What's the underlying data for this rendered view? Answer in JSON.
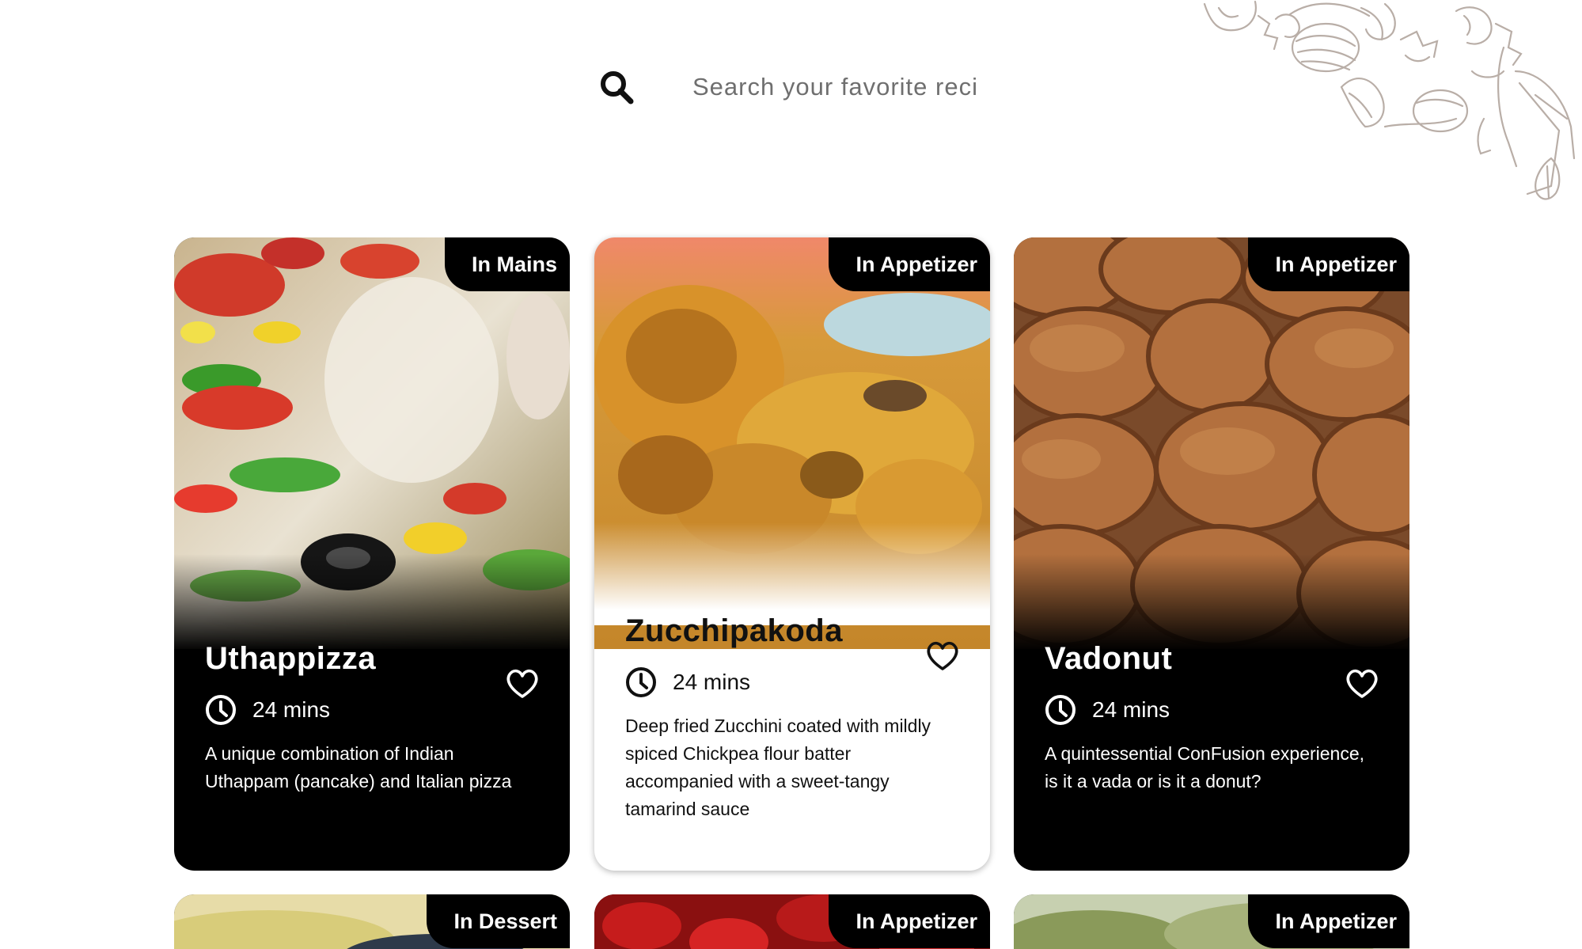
{
  "search": {
    "placeholder": "Search your favorite reci"
  },
  "recipes": [
    {
      "category": "In Mains",
      "title": "Uthappizza",
      "time": "24 mins",
      "description": "A unique combination of Indian Uthappam (pancake) and Italian pizza",
      "theme": "dark"
    },
    {
      "category": "In Appetizer",
      "title": "Zucchipakoda",
      "time": "24 mins",
      "description": "Deep fried Zucchini coated with mildly spiced Chickpea flour batter accompanied with a sweet-tangy tamarind sauce",
      "theme": "light"
    },
    {
      "category": "In Appetizer",
      "title": "Vadonut",
      "time": "24 mins",
      "description": "A quintessential ConFusion experience, is it a vada or is it a donut?",
      "theme": "dark"
    },
    {
      "category": "In Dessert"
    },
    {
      "category": "In Appetizer"
    },
    {
      "category": "In Appetizer"
    }
  ],
  "icons": {
    "search": "search-icon",
    "clock": "clock-icon",
    "favorite": "heart-outline-icon"
  },
  "colors": {
    "card_dark": "#000000",
    "card_light": "#ffffff",
    "tag_bg": "#000000",
    "tag_text": "#ffffff"
  }
}
